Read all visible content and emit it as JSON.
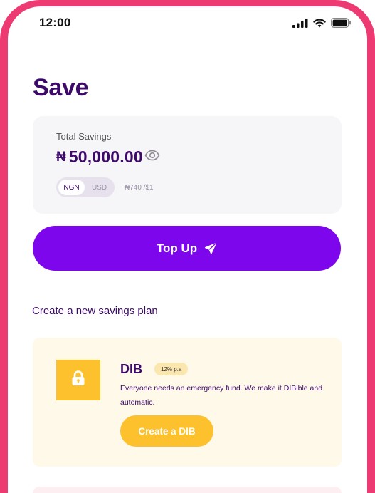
{
  "status_bar": {
    "time": "12:00"
  },
  "page": {
    "title": "Save"
  },
  "savings": {
    "label": "Total Savings",
    "currency_symbol": "₦",
    "amount": "50,000.00",
    "currency_options": [
      "NGN",
      "USD"
    ],
    "selected_currency": "NGN",
    "exchange_rate": "₦740 /$1"
  },
  "topup": {
    "label": "Top Up"
  },
  "plans_section": {
    "title": "Create a new savings plan"
  },
  "plan": {
    "name": "DIB",
    "rate": "12% p.a",
    "description": "Everyone needs an emergency fund. We make it DIBible and automatic.",
    "button_label": "Create a DIB"
  },
  "colors": {
    "frame": "#ee3a72",
    "primary": "#7e06ec",
    "heading": "#3d0a6b",
    "plan_accent": "#fcc12c",
    "plan_background": "#fff9ea"
  },
  "icons": {
    "status": [
      "cellular-signal-icon",
      "wifi-icon",
      "battery-icon"
    ],
    "balance_visibility": "eye-icon",
    "topup": "send-icon",
    "plan": "lock-icon"
  }
}
